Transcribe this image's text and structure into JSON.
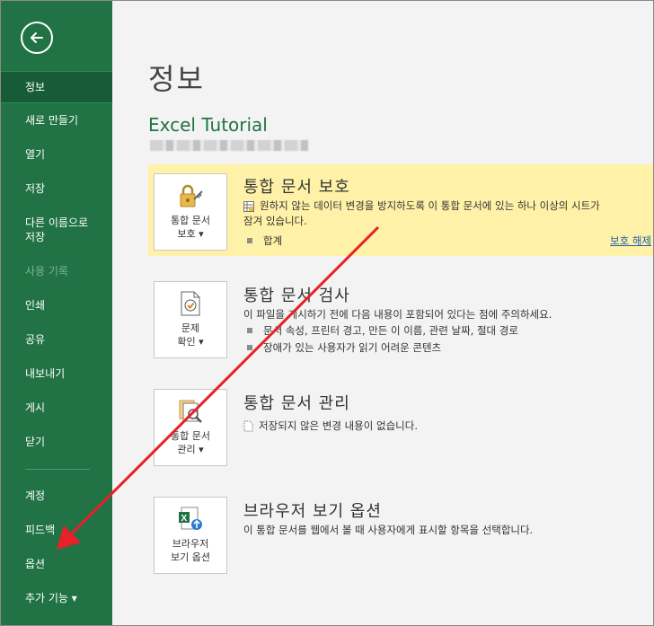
{
  "sidebar": {
    "items": [
      {
        "label": "정보"
      },
      {
        "label": "새로 만들기"
      },
      {
        "label": "열기"
      },
      {
        "label": "저장"
      },
      {
        "label": "다른 이름으로\n저장"
      },
      {
        "label": "사용 기록"
      },
      {
        "label": "인쇄"
      },
      {
        "label": "공유"
      },
      {
        "label": "내보내기"
      },
      {
        "label": "게시"
      },
      {
        "label": "닫기"
      },
      {
        "label": "계정"
      },
      {
        "label": "피드백"
      },
      {
        "label": "옵션"
      },
      {
        "label": "추가 기능 ▾"
      }
    ]
  },
  "main": {
    "title": "정보",
    "doc_title": "Excel Tutorial",
    "protect": {
      "button_label": "통합 문서\n보호 ▾",
      "heading": "통합 문서 보호",
      "desc_line1": "원하지 않는 데이터 변경을 방지하도록 이 통합 문서에 있는 하나 이상의 시트가",
      "desc_line2": "잠겨 있습니다.",
      "item": "합계",
      "link": "보호 해제"
    },
    "inspect": {
      "button_label": "문제\n확인 ▾",
      "heading": "통합 문서 검사",
      "desc": "이 파일을 게시하기 전에 다음 내용이 포함되어 있다는 점에 주의하세요.",
      "items": [
        "문서 속성, 프린터 경고, 만든 이 이름, 관련 날짜, 절대 경로",
        "장애가 있는 사용자가 읽기 어려운 콘텐츠"
      ]
    },
    "manage": {
      "button_label": "통합 문서\n관리 ▾",
      "heading": "통합 문서 관리",
      "desc": "저장되지 않은 변경 내용이 없습니다."
    },
    "browser": {
      "button_label": "브라우저\n보기 옵션",
      "heading": "브라우저 보기 옵션",
      "desc": "이 통합 문서를 웹에서 볼 때 사용자에게 표시할 항목을 선택합니다."
    }
  },
  "colors": {
    "brand": "#217346",
    "active": "#185c37",
    "highlight": "#fff2a8",
    "annotation_arrow": "#e8202a"
  }
}
